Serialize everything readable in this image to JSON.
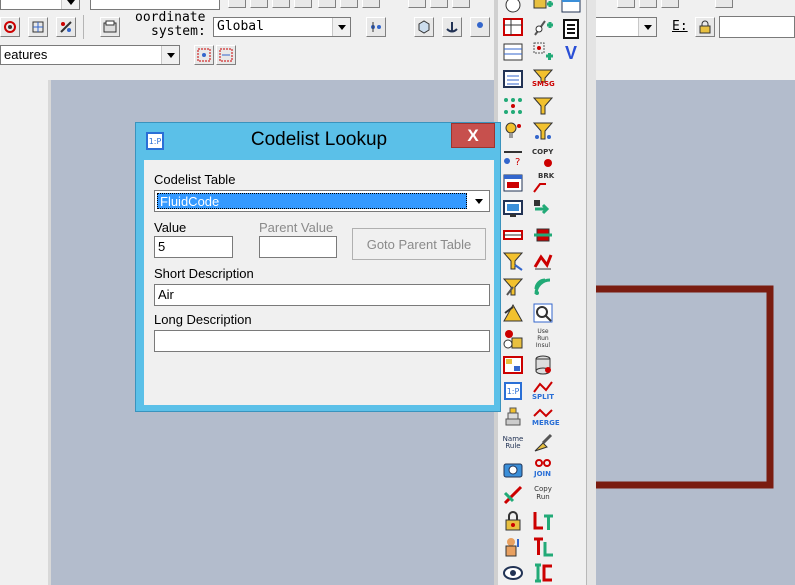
{
  "toolbar": {
    "coord_label_line1": "oordinate",
    "coord_label_line2": "system:",
    "coord_value": "Global",
    "e_label": "E:",
    "features_value": "eatures"
  },
  "dialog": {
    "title": "Codelist Lookup",
    "icon_text": "1:P",
    "close_glyph": "X",
    "codelist_table_label": "Codelist Table",
    "codelist_table_value": "FluidCode",
    "value_label": "Value",
    "value": "5",
    "parent_value_label": "Parent Value",
    "parent_value": "",
    "goto_parent_label": "Goto Parent Table",
    "short_desc_label": "Short Description",
    "short_desc": "Air",
    "long_desc_label": "Long Description",
    "long_desc": ""
  },
  "palette": {
    "col2_labels": [
      "SMSG",
      "COPY",
      "BRK",
      "SPLIT",
      "MERGE",
      "JOIN",
      "Copy Run",
      "Use Run Insul"
    ],
    "col1_labels": [
      "Name Rule",
      "1:P"
    ],
    "v_label": "V"
  },
  "colors": {
    "canvas": "#b3bccc",
    "dialog_frame": "#5bc0e8",
    "close_button": "#c7504d",
    "selection": "#3399ff",
    "shape_outline": "#7a1c10"
  }
}
